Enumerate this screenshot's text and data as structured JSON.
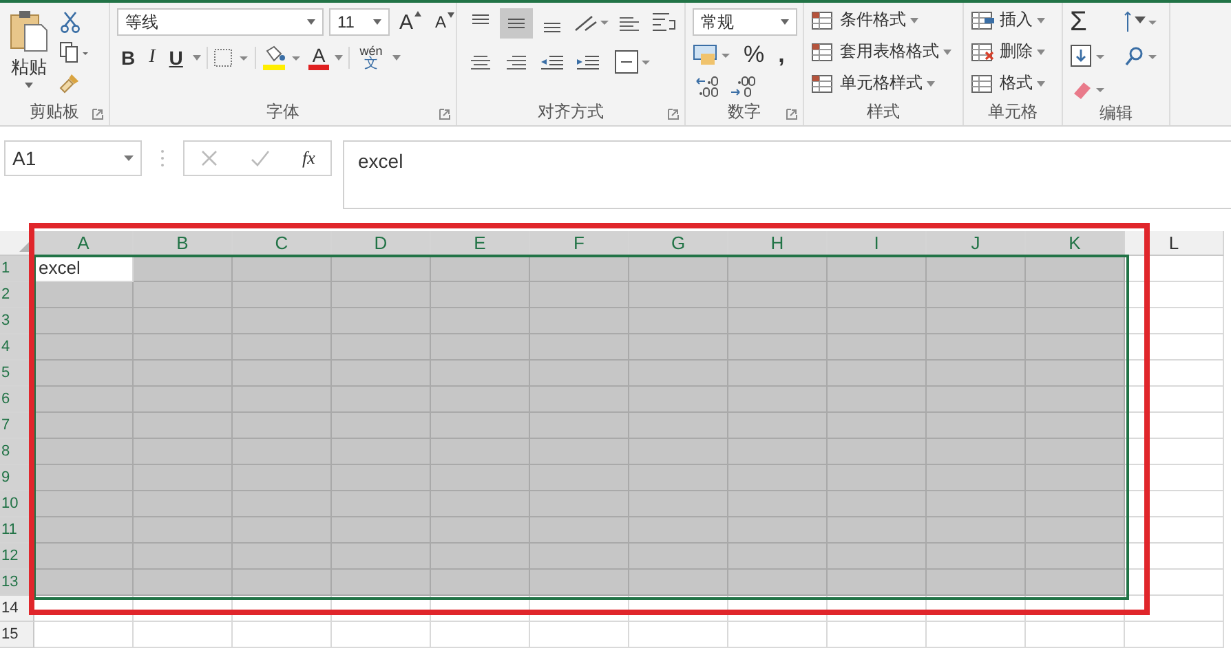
{
  "ribbon": {
    "groups": [
      {
        "kind": "clipboard",
        "label": "剪贴板",
        "paste": "粘贴"
      },
      {
        "kind": "font",
        "label": "字体",
        "font": "等线",
        "size": "11",
        "grow": "A",
        "shrink": "A",
        "bold": "B",
        "italic": "I",
        "underline": "U",
        "font_color": "A",
        "phonetic": "wén",
        "phonetic_base": "文"
      },
      {
        "kind": "alignment",
        "label": "对齐方式",
        "vertical": [
          {
            "selected": false
          },
          {
            "selected": true
          },
          {
            "selected": false
          }
        ]
      },
      {
        "kind": "number",
        "label": "数字",
        "format": "常规",
        "percent": "%",
        "comma": ","
      },
      {
        "kind": "styles",
        "label": "样式",
        "items": [
          "条件格式",
          "套用表格格式",
          "单元格样式"
        ]
      },
      {
        "kind": "cells",
        "label": "单元格",
        "items": [
          "插入",
          "删除",
          "格式"
        ]
      },
      {
        "kind": "editing",
        "label": "编辑",
        "sum": "Σ"
      }
    ]
  },
  "formula_bar": {
    "name_box": "A1",
    "fx": "fx",
    "content": "excel"
  },
  "sheet": {
    "columns": [
      {
        "label": "A",
        "selected": true
      },
      {
        "label": "B",
        "selected": true
      },
      {
        "label": "C",
        "selected": true
      },
      {
        "label": "D",
        "selected": true
      },
      {
        "label": "E",
        "selected": true
      },
      {
        "label": "F",
        "selected": true
      },
      {
        "label": "G",
        "selected": true
      },
      {
        "label": "H",
        "selected": true
      },
      {
        "label": "I",
        "selected": true
      },
      {
        "label": "J",
        "selected": true
      },
      {
        "label": "K",
        "selected": true
      },
      {
        "label": "L",
        "selected": false
      }
    ],
    "rows": [
      {
        "label": "1",
        "selected": true,
        "cells": [
          {
            "value": "excel",
            "active": true
          }
        ]
      },
      {
        "label": "2",
        "selected": true
      },
      {
        "label": "3",
        "selected": true
      },
      {
        "label": "4",
        "selected": true
      },
      {
        "label": "5",
        "selected": true
      },
      {
        "label": "6",
        "selected": true
      },
      {
        "label": "7",
        "selected": true
      },
      {
        "label": "8",
        "selected": true
      },
      {
        "label": "9",
        "selected": true
      },
      {
        "label": "10",
        "selected": true
      },
      {
        "label": "11",
        "selected": true
      },
      {
        "label": "12",
        "selected": true
      },
      {
        "label": "13",
        "selected": true
      },
      {
        "label": "14",
        "selected": false
      },
      {
        "label": "15",
        "selected": false
      }
    ],
    "highlight_frame": {
      "kind": "rectangle"
    }
  }
}
